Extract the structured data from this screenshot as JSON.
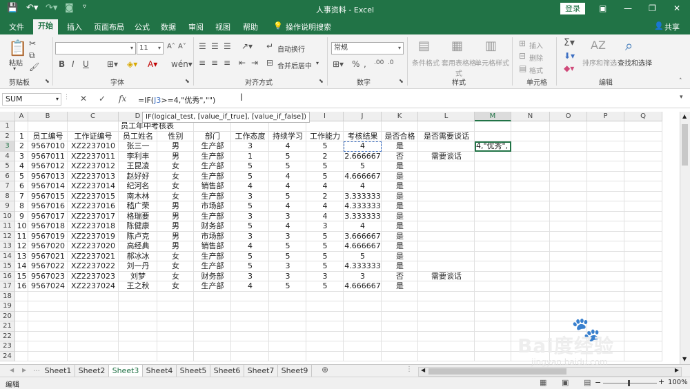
{
  "app": {
    "title": "人事资料 - Excel",
    "login": "登录",
    "share": "共享"
  },
  "tabs": [
    "文件",
    "开始",
    "插入",
    "页面布局",
    "公式",
    "数据",
    "审阅",
    "视图",
    "帮助",
    "操作说明搜索"
  ],
  "ribbon": {
    "clipboard": {
      "paste": "粘贴",
      "label": "剪贴板"
    },
    "font": {
      "size": "11",
      "bold": "B",
      "italic": "I",
      "underline": "U",
      "label": "字体"
    },
    "align": {
      "wrap": "自动换行",
      "merge": "合并后居中",
      "label": "对齐方式"
    },
    "number": {
      "format": "常规",
      "label": "数字"
    },
    "styles": {
      "cond": "条件格式",
      "table": "套用表格格式",
      "cell": "单元格样式",
      "label": "样式"
    },
    "cells": {
      "insert": "插入",
      "delete": "删除",
      "format": "格式",
      "label": "单元格"
    },
    "editing": {
      "sort": "排序和筛选",
      "find": "查找和选择",
      "label": "编辑"
    }
  },
  "formula_bar": {
    "name_box": "SUM",
    "formula_prefix": "=IF(",
    "formula_ref": "J3",
    "formula_suffix": ">=4,\"优秀\",\"\")",
    "tooltip": "IF(logical_test, [value_if_true], [value_if_false])"
  },
  "columns": [
    "A",
    "B",
    "C",
    "D",
    "E",
    "F",
    "G",
    "H",
    "I",
    "J",
    "K",
    "L",
    "M",
    "N",
    "O",
    "P",
    "Q"
  ],
  "sheet_title": "员工年中考核表",
  "headers": [
    "员工编号",
    "工作证编号",
    "员工姓名",
    "性别",
    "部门",
    "工作态度",
    "持续学习",
    "工作能力",
    "考核结果",
    "是否合格",
    "是否需要谈话"
  ],
  "rows": [
    [
      "9567010",
      "XZ2237010",
      "张三一",
      "男",
      "生产部",
      "3",
      "4",
      "5",
      "4",
      "是",
      ""
    ],
    [
      "9567011",
      "XZ2237011",
      "李利丰",
      "男",
      "生产部",
      "1",
      "5",
      "2",
      "2.666667",
      "否",
      "需要谈话"
    ],
    [
      "9567012",
      "XZ2237012",
      "王昆凌",
      "女",
      "生产部",
      "5",
      "5",
      "5",
      "5",
      "是",
      ""
    ],
    [
      "9567013",
      "XZ2237013",
      "赵好好",
      "女",
      "生产部",
      "5",
      "4",
      "5",
      "4.666667",
      "是",
      ""
    ],
    [
      "9567014",
      "XZ2237014",
      "纪河名",
      "女",
      "销售部",
      "4",
      "4",
      "4",
      "4",
      "是",
      ""
    ],
    [
      "9567015",
      "XZ2237015",
      "南木林",
      "女",
      "生产部",
      "3",
      "5",
      "2",
      "3.333333",
      "是",
      ""
    ],
    [
      "9567016",
      "XZ2237016",
      "嵇广荣",
      "男",
      "市场部",
      "5",
      "4",
      "4",
      "4.333333",
      "是",
      ""
    ],
    [
      "9567017",
      "XZ2237017",
      "格瑞要",
      "男",
      "生产部",
      "3",
      "3",
      "4",
      "3.333333",
      "是",
      ""
    ],
    [
      "9567018",
      "XZ2237018",
      "陈健康",
      "男",
      "财务部",
      "5",
      "4",
      "3",
      "4",
      "是",
      ""
    ],
    [
      "9567019",
      "XZ2237019",
      "陈卢克",
      "男",
      "市场部",
      "3",
      "3",
      "5",
      "3.666667",
      "是",
      ""
    ],
    [
      "9567020",
      "XZ2237020",
      "高经典",
      "男",
      "销售部",
      "4",
      "5",
      "5",
      "4.666667",
      "是",
      ""
    ],
    [
      "9567021",
      "XZ2237021",
      "郝冰冰",
      "女",
      "生产部",
      "5",
      "5",
      "5",
      "5",
      "是",
      ""
    ],
    [
      "9567022",
      "XZ2237022",
      "刘一丹",
      "女",
      "生产部",
      "5",
      "3",
      "5",
      "4.333333",
      "是",
      ""
    ],
    [
      "9567023",
      "XZ2237023",
      "刘梦",
      "女",
      "财务部",
      "3",
      "3",
      "3",
      "3",
      "否",
      "需要谈话"
    ],
    [
      "9567024",
      "XZ2237024",
      "王之秋",
      "女",
      "生产部",
      "4",
      "5",
      "5",
      "4.666667",
      "是",
      ""
    ]
  ],
  "row_indices": [
    "1",
    "2",
    "3",
    "4",
    "5",
    "6",
    "7",
    "8",
    "9",
    "10",
    "11",
    "12",
    "13",
    "14",
    "15",
    "16"
  ],
  "m3_edit": "4,\"优秀\",",
  "sheets": [
    "Sheet1",
    "Sheet2",
    "Sheet3",
    "Sheet4",
    "Sheet5",
    "Sheet6",
    "Sheet7",
    "Sheet9"
  ],
  "active_sheet": "Sheet3",
  "status": {
    "mode": "编辑",
    "zoom": "100%"
  },
  "watermark": {
    "text": "Bai度经验",
    "url": "jingyan.baidu.com"
  }
}
